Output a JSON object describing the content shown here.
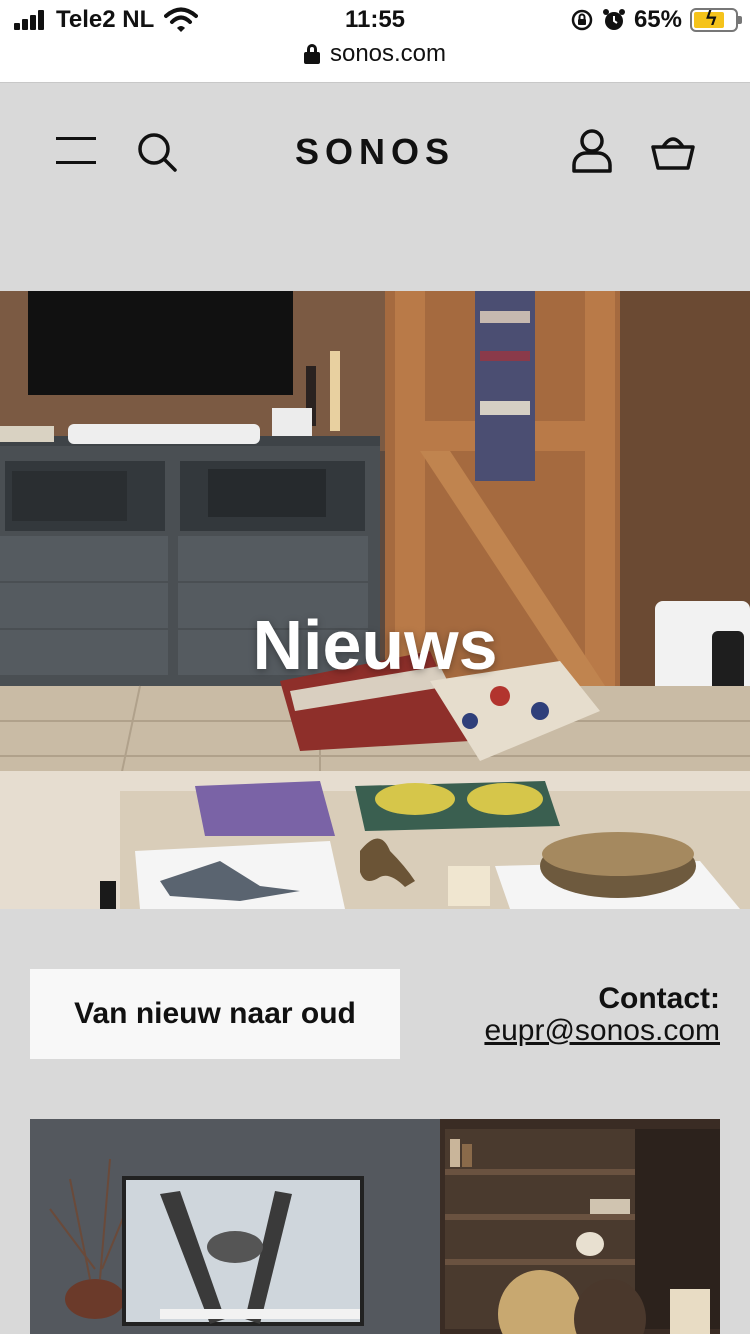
{
  "status_bar": {
    "carrier": "Tele2 NL",
    "time": "11:55",
    "battery": "65%"
  },
  "url_bar": {
    "domain": "sonos.com"
  },
  "header": {
    "logo": "SONOS",
    "icons": [
      "menu-icon",
      "search-icon",
      "account-icon",
      "cart-icon"
    ]
  },
  "hero": {
    "title": "Nieuws"
  },
  "toolbar": {
    "sort_label": "Van nieuw naar oud",
    "contact_label": "Contact:",
    "contact_email": "eupr@sonos.com"
  },
  "colors": {
    "page_bg": "#d9d9d9",
    "button_bg": "#f8f8f8",
    "text": "#111111",
    "battery": "#f5c31b"
  }
}
